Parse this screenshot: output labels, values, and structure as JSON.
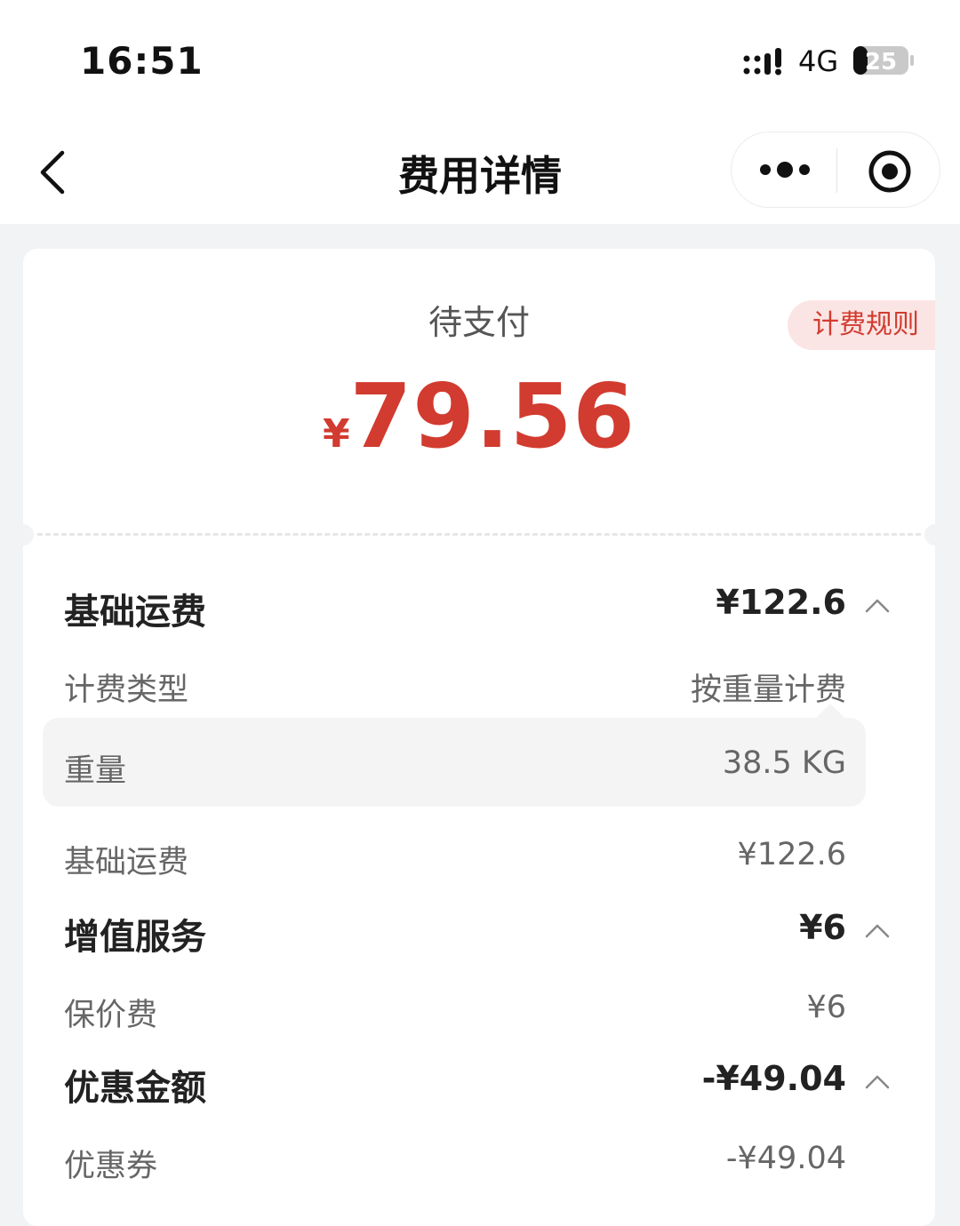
{
  "status_bar": {
    "time": "16:51",
    "network": "4G",
    "battery": "25"
  },
  "nav": {
    "title": "费用详情"
  },
  "summary": {
    "label": "待支付",
    "currency": "¥",
    "amount": "79.56",
    "rule_button": "计费规则"
  },
  "sections": [
    {
      "title": "基础运费",
      "amount": "¥122.6",
      "items": [
        {
          "label": "计费类型",
          "value": "按重量计费"
        },
        {
          "label": "重量",
          "value": "38.5 KG"
        },
        {
          "label": "基础运费",
          "value": "¥122.6"
        }
      ]
    },
    {
      "title": "增值服务",
      "amount": "¥6",
      "items": [
        {
          "label": "保价费",
          "value": "¥6"
        }
      ]
    },
    {
      "title": "优惠金额",
      "amount": "-¥49.04",
      "items": [
        {
          "label": "优惠券",
          "value": "-¥49.04"
        }
      ]
    }
  ],
  "colors": {
    "accent": "#d23b2f",
    "badge_bg": "#fbe5e4",
    "page_bg": "#f2f3f5"
  }
}
